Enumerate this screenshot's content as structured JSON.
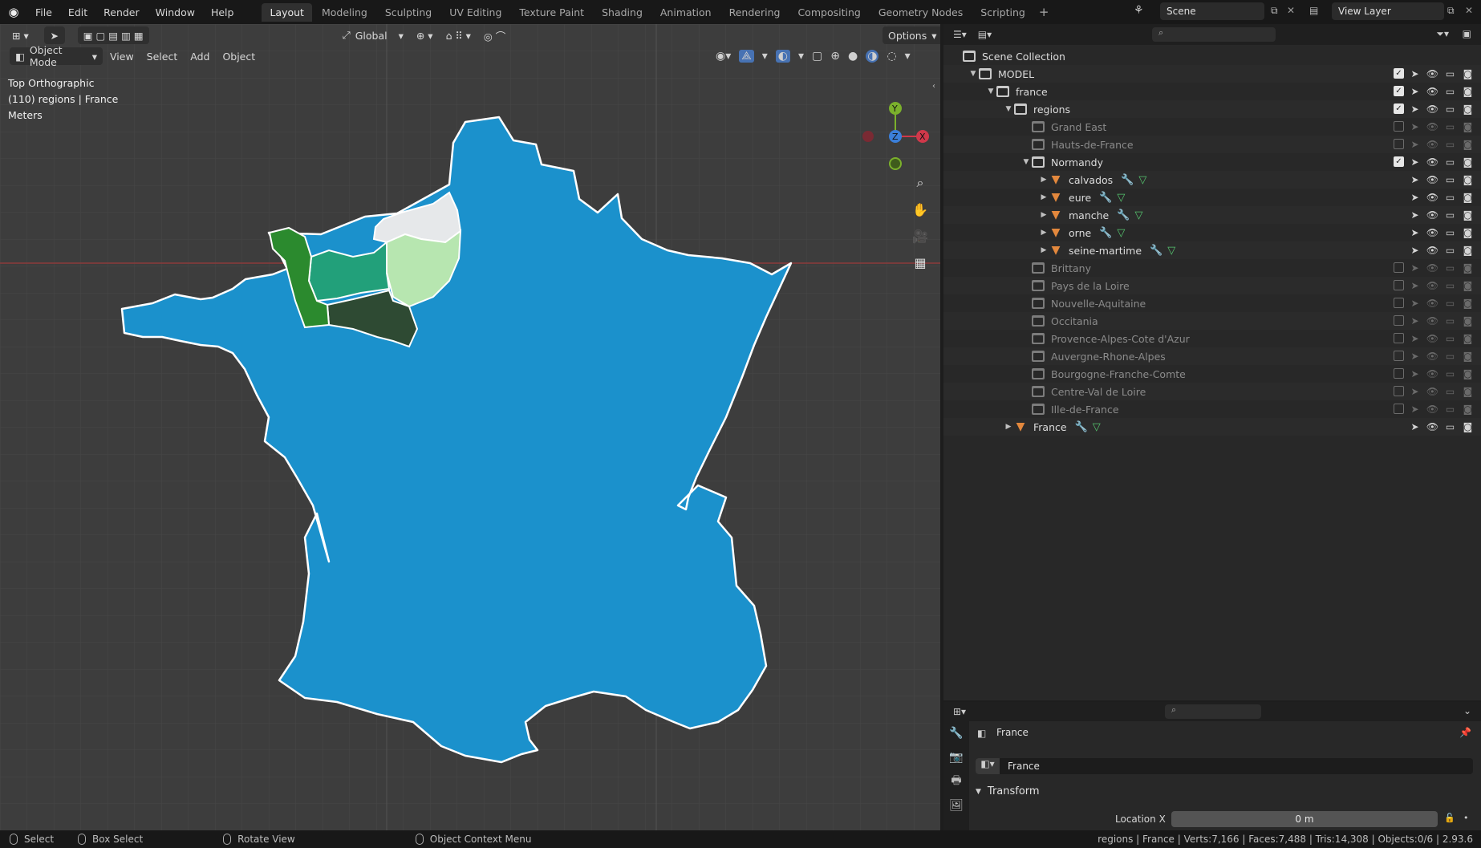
{
  "menu": [
    "File",
    "Edit",
    "Render",
    "Window",
    "Help"
  ],
  "workspaces": [
    "Layout",
    "Modeling",
    "Sculpting",
    "UV Editing",
    "Texture Paint",
    "Shading",
    "Animation",
    "Rendering",
    "Compositing",
    "Geometry Nodes",
    "Scripting"
  ],
  "active_workspace": "Layout",
  "scene": "Scene",
  "view_layer": "View Layer",
  "viewport": {
    "mode": "Object Mode",
    "menus": [
      "View",
      "Select",
      "Add",
      "Object"
    ],
    "transform_orientation": "Global",
    "options_label": "Options",
    "info": [
      "Top Orthographic",
      "(110) regions | France",
      "Meters"
    ]
  },
  "map_colors": {
    "france": "#1b91cc",
    "manche": "#2b8a2e",
    "calvados": "#22a07a",
    "eure": "#b7e6b0",
    "orne": "#2e4a33",
    "seine_maritime": "#e6e8ea",
    "outline": "#ffffff"
  },
  "outliner": {
    "root": "Scene Collection",
    "rows": [
      {
        "label": "MODEL",
        "indent": 1,
        "arrow": "down",
        "type": "collection",
        "check": true,
        "dim": false
      },
      {
        "label": "france",
        "indent": 2,
        "arrow": "down",
        "type": "collection",
        "check": true,
        "dim": false
      },
      {
        "label": "regions",
        "indent": 3,
        "arrow": "down",
        "type": "collection",
        "check": true,
        "dim": false
      },
      {
        "label": "Grand East",
        "indent": 4,
        "arrow": "",
        "type": "collection",
        "check": false,
        "dim": true
      },
      {
        "label": "Hauts-de-France",
        "indent": 4,
        "arrow": "",
        "type": "collection",
        "check": false,
        "dim": true
      },
      {
        "label": "Normandy",
        "indent": 4,
        "arrow": "down",
        "type": "collection",
        "check": true,
        "dim": false
      },
      {
        "label": "calvados",
        "indent": 5,
        "arrow": "right",
        "type": "mesh",
        "check": null,
        "dim": false
      },
      {
        "label": "eure",
        "indent": 5,
        "arrow": "right",
        "type": "mesh",
        "check": null,
        "dim": false
      },
      {
        "label": "manche",
        "indent": 5,
        "arrow": "right",
        "type": "mesh",
        "check": null,
        "dim": false
      },
      {
        "label": "orne",
        "indent": 5,
        "arrow": "right",
        "type": "mesh",
        "check": null,
        "dim": false
      },
      {
        "label": "seine-martime",
        "indent": 5,
        "arrow": "right",
        "type": "mesh",
        "check": null,
        "dim": false
      },
      {
        "label": "Brittany",
        "indent": 4,
        "arrow": "",
        "type": "collection",
        "check": false,
        "dim": true
      },
      {
        "label": "Pays de la Loire",
        "indent": 4,
        "arrow": "",
        "type": "collection",
        "check": false,
        "dim": true
      },
      {
        "label": "Nouvelle-Aquitaine",
        "indent": 4,
        "arrow": "",
        "type": "collection",
        "check": false,
        "dim": true
      },
      {
        "label": "Occitania",
        "indent": 4,
        "arrow": "",
        "type": "collection",
        "check": false,
        "dim": true
      },
      {
        "label": "Provence-Alpes-Cote d'Azur",
        "indent": 4,
        "arrow": "",
        "type": "collection",
        "check": false,
        "dim": true
      },
      {
        "label": "Auvergne-Rhone-Alpes",
        "indent": 4,
        "arrow": "",
        "type": "collection",
        "check": false,
        "dim": true
      },
      {
        "label": "Bourgogne-Franche-Comte",
        "indent": 4,
        "arrow": "",
        "type": "collection",
        "check": false,
        "dim": true
      },
      {
        "label": "Centre-Val de Loire",
        "indent": 4,
        "arrow": "",
        "type": "collection",
        "check": false,
        "dim": true
      },
      {
        "label": "Ille-de-France",
        "indent": 4,
        "arrow": "",
        "type": "collection",
        "check": false,
        "dim": true
      },
      {
        "label": "France",
        "indent": 3,
        "arrow": "right",
        "type": "mesh",
        "check": null,
        "dim": false
      }
    ]
  },
  "properties": {
    "object_name": "France",
    "data_name": "France",
    "panel": "Transform",
    "location_x_label": "Location X",
    "location_x_value": "0 m"
  },
  "statusbar": {
    "items": [
      "Select",
      "Box Select",
      "Rotate View",
      "Object Context Menu"
    ],
    "stats": "regions | France | Verts:7,166 | Faces:7,488 | Tris:14,308 | Objects:0/6 | 2.93.6"
  }
}
